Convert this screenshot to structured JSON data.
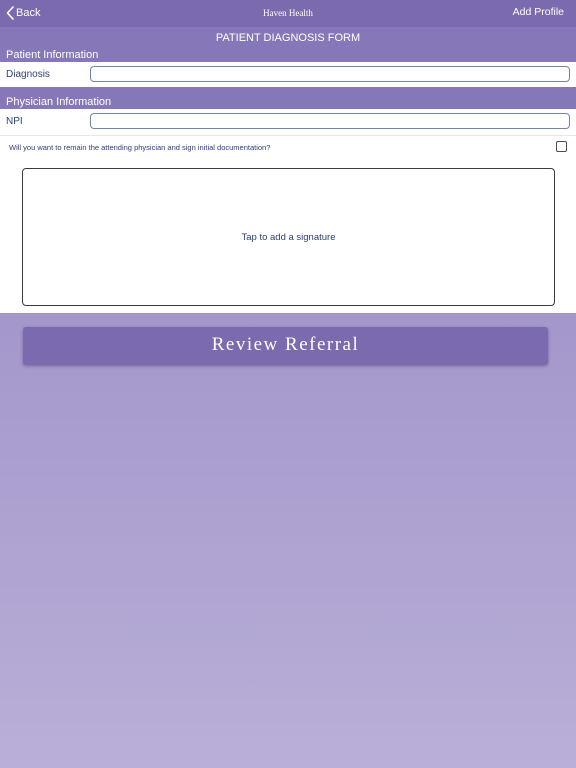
{
  "navbar": {
    "back_label": "Back",
    "title": "Haven Health",
    "right_action": "Add Profile"
  },
  "form": {
    "title": "PATIENT DIAGNOSIS FORM"
  },
  "patient_section": {
    "header": "Patient Information",
    "diagnosis_label": "Diagnosis",
    "diagnosis_value": ""
  },
  "physician_section": {
    "header": "Physician Information",
    "npi_label": "NPI",
    "npi_value": "",
    "question": "Will you want to remain the attending physician and sign initial documentation?",
    "checked": false
  },
  "signature": {
    "hint": "Tap to add a signature"
  },
  "actions": {
    "review_label": "Review Referral"
  },
  "colors": {
    "nav_bar": "#7b6aae",
    "section_header": "#8678b8",
    "label_text": "#2e3f73",
    "button": "#7b6aae"
  },
  "icons": {
    "back": "chevron-left-icon",
    "checkbox": "checkbox-icon"
  }
}
